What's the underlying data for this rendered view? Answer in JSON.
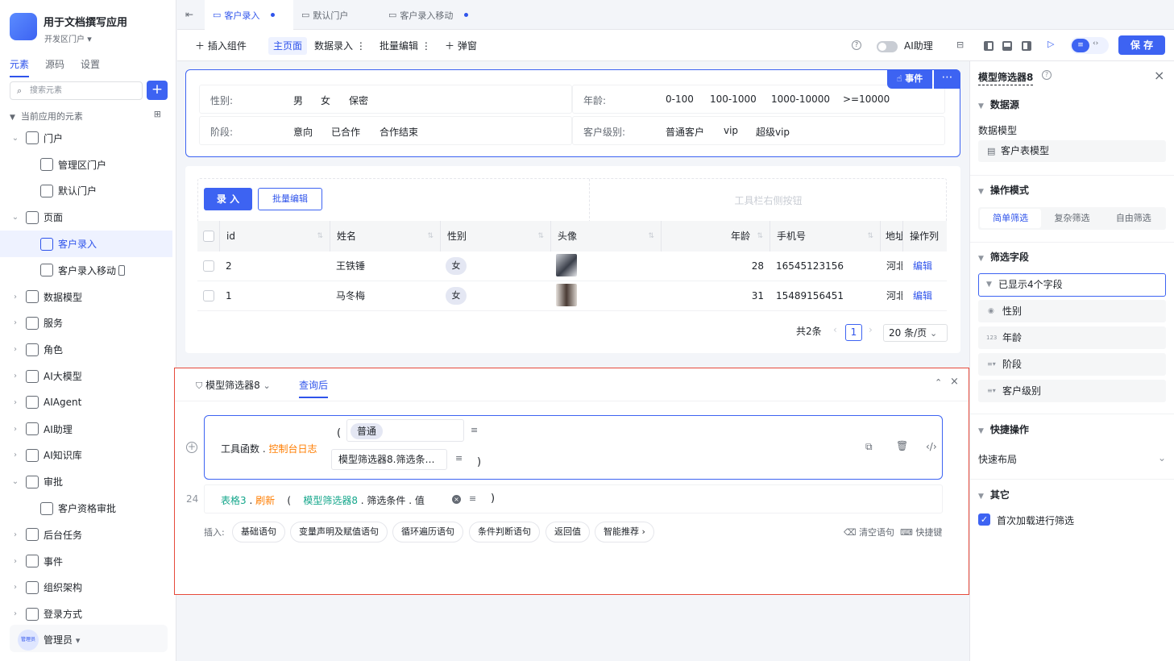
{
  "app": {
    "name": "用于文档撰写应用",
    "portal": "开发区门户"
  },
  "left_tabs": [
    "元素",
    "源码",
    "设置"
  ],
  "search": {
    "placeholder": "搜索元素"
  },
  "section_title": "当前应用的元素",
  "tree": [
    {
      "label": "门户",
      "level": 0,
      "expanded": true
    },
    {
      "label": "管理区门户",
      "level": 1
    },
    {
      "label": "默认门户",
      "level": 1
    },
    {
      "label": "页面",
      "level": 0,
      "expanded": true
    },
    {
      "label": "客户录入",
      "level": 1,
      "selected": true
    },
    {
      "label": "客户录入移动",
      "level": 1
    },
    {
      "label": "数据模型",
      "level": 0
    },
    {
      "label": "服务",
      "level": 0
    },
    {
      "label": "角色",
      "level": 0
    },
    {
      "label": "AI大模型",
      "level": 0
    },
    {
      "label": "AIAgent",
      "level": 0
    },
    {
      "label": "AI助理",
      "level": 0
    },
    {
      "label": "AI知识库",
      "level": 0
    },
    {
      "label": "审批",
      "level": 0,
      "expanded": true
    },
    {
      "label": "客户资格审批",
      "level": 1
    },
    {
      "label": "后台任务",
      "level": 0
    },
    {
      "label": "事件",
      "level": 0
    },
    {
      "label": "组织架构",
      "level": 0
    },
    {
      "label": "登录方式",
      "level": 0
    }
  ],
  "user": {
    "avatar_text": "管理员",
    "name": "管理员"
  },
  "top_tabs": [
    "客户录入",
    "默认门户",
    "客户录入移动"
  ],
  "toolbar": {
    "insert": "插入组件",
    "main_page": "主页面",
    "data_entry": "数据录入",
    "batch_edit": "批量编辑",
    "popup": "弹窗",
    "ai_assist": "AI助理",
    "save": "保 存"
  },
  "filter": {
    "gender_label": "性别:",
    "gender_opts": [
      "男",
      "女",
      "保密"
    ],
    "age_label": "年龄:",
    "age_opts": [
      "0-100",
      "100-1000",
      "1000-10000",
      ">=10000"
    ],
    "stage_label": "阶段:",
    "stage_opts": [
      "意向",
      "已合作",
      "合作结束"
    ],
    "level_label": "客户级别:",
    "level_opts": [
      "普通客户",
      "vip",
      "超级vip"
    ],
    "event_btn": "事件"
  },
  "table": {
    "entry_btn": "录 入",
    "batch_btn": "批量编辑",
    "toolbar_right": "工具栏右侧按钮",
    "columns": [
      "id",
      "姓名",
      "性别",
      "头像",
      "年龄",
      "手机号",
      "地址",
      "操作列"
    ],
    "rows": [
      {
        "id": "2",
        "name": "王铁锤",
        "gender": "女",
        "age": "28",
        "phone": "16545123156",
        "addr": "河北",
        "op": "编辑"
      },
      {
        "id": "1",
        "name": "马冬梅",
        "gender": "女",
        "age": "31",
        "phone": "15489156451",
        "addr": "河北",
        "op": "编辑"
      }
    ],
    "total": "共2条",
    "page": "1",
    "page_size": "20 条/页"
  },
  "bottom": {
    "component": "模型筛选器8",
    "tab": "查询后",
    "stmt1_obj": "工具函数",
    "stmt1_method": "控制台日志",
    "stmt1_arg1": "普通",
    "stmt1_arg2": "模型筛选器8.筛选条…",
    "line_no": "24",
    "stmt2_obj": "表格3",
    "stmt2_method": "刷新",
    "stmt2_arg_a": "模型筛选器8",
    "stmt2_arg_b": "筛选条件",
    "stmt2_arg_c": "值",
    "insert_label": "插入:",
    "insert_btns": [
      "基础语句",
      "变量声明及赋值语句",
      "循环遍历语句",
      "条件判断语句",
      "返回值",
      "智能推荐 ›"
    ],
    "clear": "清空语句",
    "shortcut": "快捷键"
  },
  "right": {
    "title": "模型筛选器8",
    "datasource": "数据源",
    "model_label": "数据模型",
    "model_value": "客户表模型",
    "mode": "操作模式",
    "mode_opts": [
      "简单筛选",
      "复杂筛选",
      "自由筛选"
    ],
    "fields": "筛选字段",
    "fields_dropdown": "已显示4个字段",
    "field_items": [
      "性别",
      "年龄",
      "阶段",
      "客户级别"
    ],
    "quick": "快捷操作",
    "quick_layout": "快速布局",
    "other": "其它",
    "first_load": "首次加载进行筛选"
  }
}
